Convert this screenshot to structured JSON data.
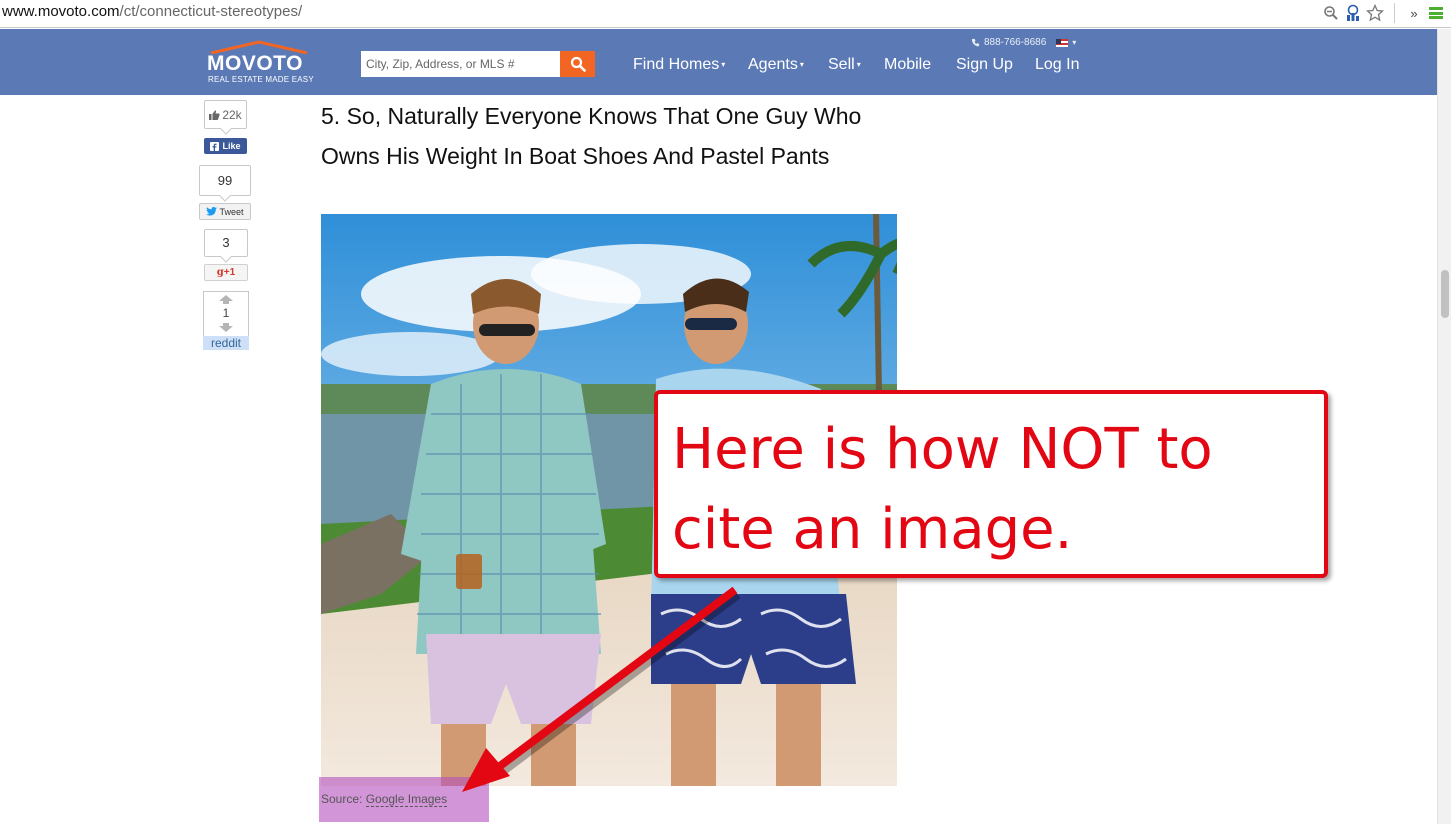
{
  "browser": {
    "url_host": "www.movoto.com",
    "url_path": "/ct/connecticut-stereotypes/",
    "extension_label": "»"
  },
  "site": {
    "logo_text": "MOVOTO",
    "logo_tagline": "REAL ESTATE MADE EASY",
    "search_placeholder": "City, Zip, Address, or MLS #",
    "phone": "888-766-8686",
    "nav": [
      {
        "label": "Find Homes",
        "caret": "▾"
      },
      {
        "label": "Agents",
        "caret": "▾"
      },
      {
        "label": "Sell",
        "caret": "▾"
      },
      {
        "label": "Mobile"
      },
      {
        "label": "Sign Up"
      },
      {
        "label": "Log In"
      }
    ],
    "accent_color": "#f26522",
    "header_color": "#5b7ab5"
  },
  "share": {
    "facebook_count": "22k",
    "facebook_label": "Like",
    "twitter_count": "99",
    "twitter_label": "Tweet",
    "gplus_count": "3",
    "gplus_label": "+1",
    "reddit_count": "1",
    "reddit_label": "reddit"
  },
  "article": {
    "title": "5. So, Naturally Everyone Knows That One Guy Who Owns His Weight In Boat Shoes And Pastel Pants",
    "source_prefix": "Source:",
    "source_link": "Google Images"
  },
  "annotation": {
    "text": "Here is how NOT to cite an image.",
    "color": "#e30613"
  }
}
